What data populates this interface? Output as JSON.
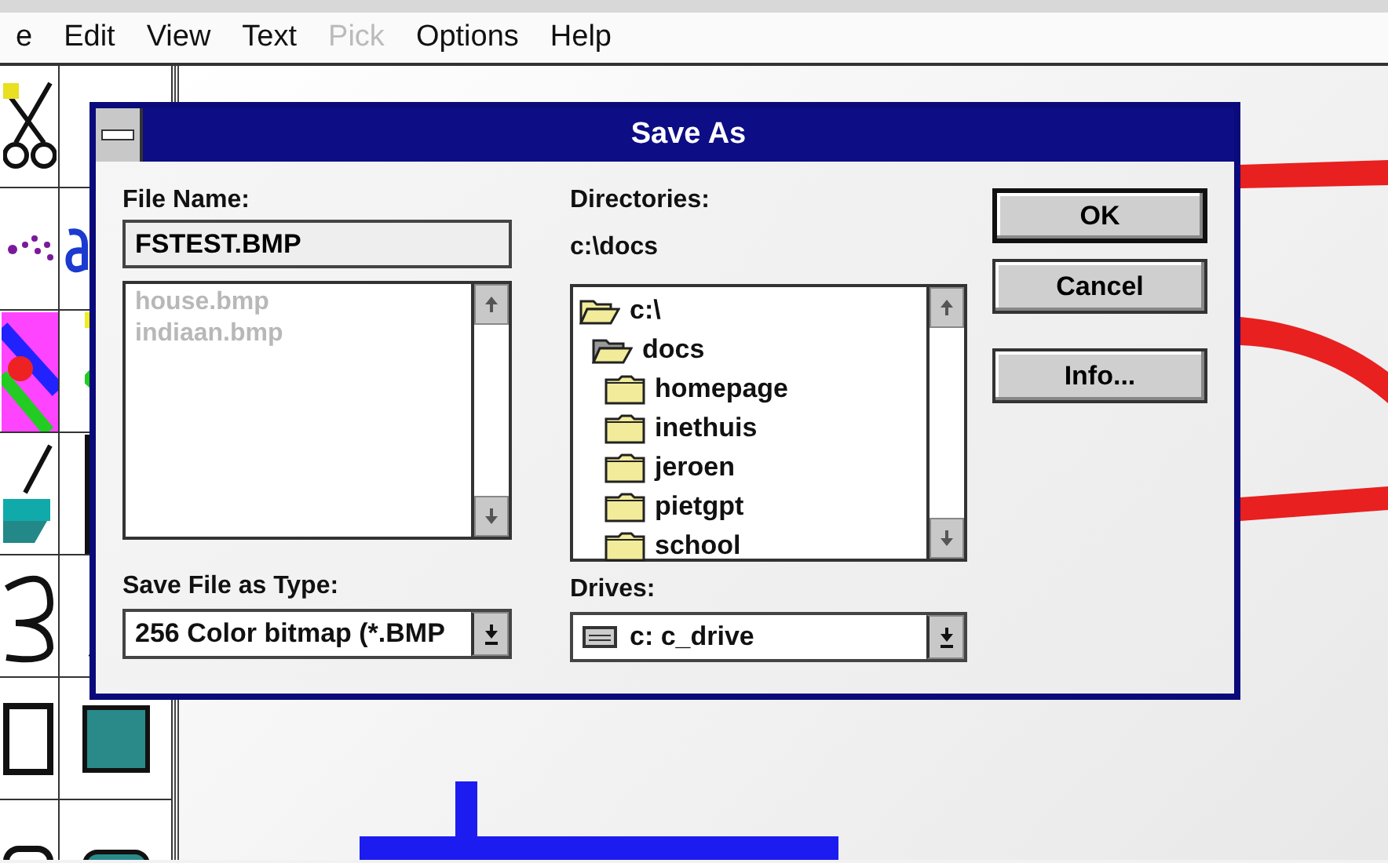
{
  "menu": [
    {
      "label": "e",
      "disabled": false
    },
    {
      "label": "Edit",
      "disabled": false
    },
    {
      "label": "View",
      "disabled": false
    },
    {
      "label": "Text",
      "disabled": false
    },
    {
      "label": "Pick",
      "disabled": true
    },
    {
      "label": "Options",
      "disabled": false
    },
    {
      "label": "Help",
      "disabled": false
    }
  ],
  "dialog": {
    "title": "Save As",
    "file_name": {
      "label": "File Name:",
      "value": "FSTEST.BMP"
    },
    "files": {
      "disabled": true,
      "items": [
        "house.bmp",
        "indiaan.bmp"
      ]
    },
    "file_type": {
      "label": "Save File as Type:",
      "value": "256 Color bitmap (*.BMP"
    },
    "directories": {
      "label": "Directories:",
      "path": "c:\\docs",
      "tree": [
        {
          "label": "c:\\",
          "kind": "open",
          "children": [
            {
              "label": "docs",
              "kind": "current",
              "children": [
                {
                  "label": "homepage",
                  "kind": "closed"
                },
                {
                  "label": "inethuis",
                  "kind": "closed"
                },
                {
                  "label": "jeroen",
                  "kind": "closed"
                },
                {
                  "label": "pietgpt",
                  "kind": "closed"
                },
                {
                  "label": "school",
                  "kind": "closed"
                }
              ]
            }
          ]
        }
      ]
    },
    "drives": {
      "label": "Drives:",
      "value": "c: c_drive"
    },
    "buttons": [
      {
        "label": "OK",
        "default": true
      },
      {
        "label": "Cancel",
        "default": false
      },
      {
        "label": "Info...",
        "default": false
      }
    ]
  }
}
